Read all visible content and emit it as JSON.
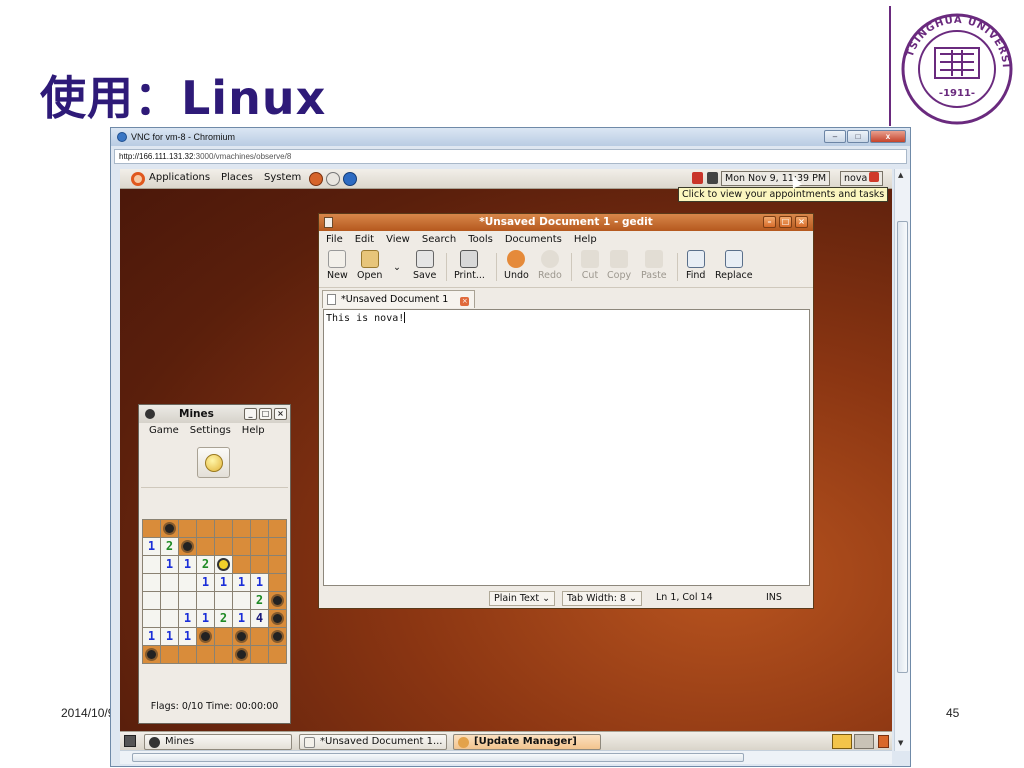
{
  "slide": {
    "title": "使用：Linux",
    "date": "2014/10/9",
    "page": "45",
    "logo": {
      "ring_text": "TSINGHUA UNIVERSITY",
      "year": "1911",
      "color": "#6a2a7e"
    }
  },
  "browser": {
    "title": "VNC for vm-8 - Chromium",
    "url_host": "http://166.111.131.32",
    "url_rest": ":3000/vmachines/observe/8",
    "buttons": {
      "minimize": "–",
      "maximize": "□",
      "close": "x"
    }
  },
  "top_panel": {
    "menu": [
      "Applications",
      "Places",
      "System"
    ],
    "clock": "Mon Nov  9, 11:39 PM",
    "user": "nova",
    "tooltip": "Click to view your appointments and tasks"
  },
  "gedit": {
    "title": "*Unsaved Document 1 - gedit",
    "menu": [
      "File",
      "Edit",
      "View",
      "Search",
      "Tools",
      "Documents",
      "Help"
    ],
    "toolbar": {
      "new": "New",
      "open": "Open",
      "save": "Save",
      "print": "Print...",
      "undo": "Undo",
      "redo": "Redo",
      "cut": "Cut",
      "copy": "Copy",
      "paste": "Paste",
      "find": "Find",
      "replace": "Replace"
    },
    "tab_label": "*Unsaved Document 1",
    "content": "This is nova!",
    "status": {
      "language": "Plain Text",
      "tab_width": "Tab Width:  8",
      "position": "Ln 1, Col 14",
      "mode": "INS"
    }
  },
  "mines": {
    "title": "Mines",
    "menu": [
      "Game",
      "Settings",
      "Help"
    ],
    "status": "Flags: 0/10   Time: 00:00:00",
    "grid": [
      [
        "c",
        "m",
        "c",
        "c",
        "c",
        "c",
        "c",
        "c"
      ],
      [
        "1",
        "2",
        "m",
        "c",
        "c",
        "c",
        "c",
        "c"
      ],
      [
        "o",
        "1",
        "1",
        "2",
        "h",
        "c",
        "c",
        "c"
      ],
      [
        "o",
        "o",
        "o",
        "1",
        "1",
        "1",
        "1",
        "c"
      ],
      [
        "o",
        "o",
        "o",
        "o",
        "o",
        "o",
        "2",
        "m"
      ],
      [
        "o",
        "o",
        "1",
        "1",
        "2",
        "1",
        "4",
        "m"
      ],
      [
        "1",
        "1",
        "1",
        "m",
        "c",
        "m",
        "c",
        "m"
      ],
      [
        "m",
        "c",
        "c",
        "c",
        "c",
        "m",
        "c",
        "c"
      ]
    ]
  },
  "taskbar": {
    "tasks": [
      "Mines",
      "*Unsaved Document 1...",
      "[Update Manager]"
    ]
  }
}
